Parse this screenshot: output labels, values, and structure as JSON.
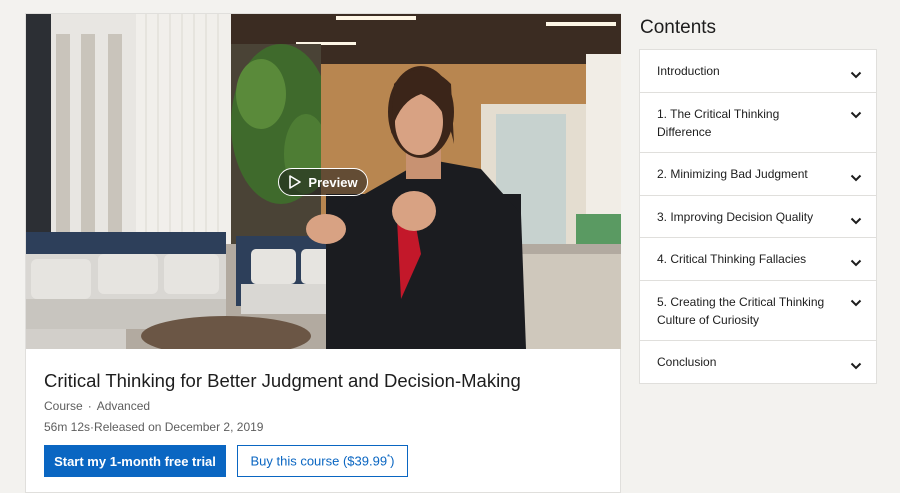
{
  "hero": {
    "preview_label": "Preview"
  },
  "course": {
    "title": "Critical Thinking for Better Judgment and Decision-Making",
    "type": "Course",
    "level": "Advanced",
    "duration": "56m 12s",
    "released": "Released on December 2, 2019"
  },
  "actions": {
    "trial_label": "Start my 1-month free trial",
    "buy_label_prefix": "Buy this course ($39.99",
    "buy_label_sup": "*",
    "buy_label_suffix": ")"
  },
  "contents": {
    "title": "Contents",
    "items": [
      "Introduction",
      "1. The Critical Thinking Difference",
      "2. Minimizing Bad Judgment",
      "3. Improving Decision Quality",
      "4. Critical Thinking Fallacies",
      "5. Creating the Critical Thinking Culture of Curiosity",
      "Conclusion"
    ]
  },
  "colors": {
    "primary": "#0a66c2",
    "text": "#1d1d1d",
    "muted": "#5e5e5e"
  },
  "icons": {
    "play": "play-icon",
    "chevron": "chevron-down-icon"
  }
}
